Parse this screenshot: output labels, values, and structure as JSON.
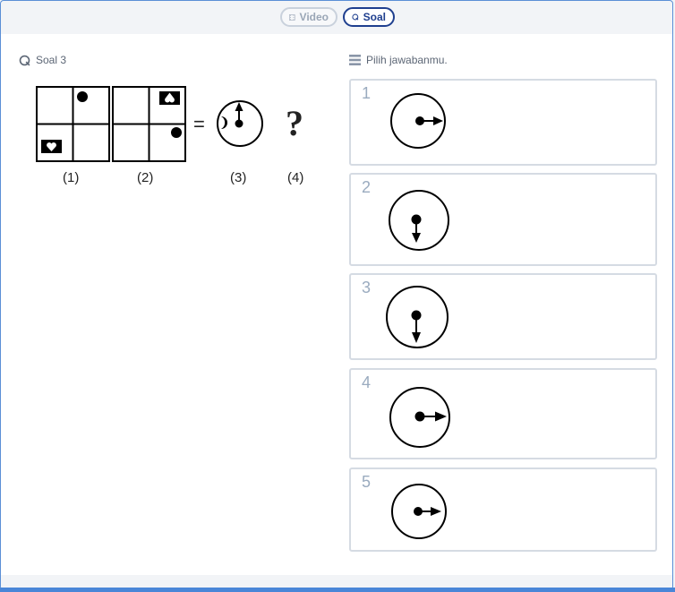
{
  "tabs": {
    "video_label": "Video",
    "soal_label": "Soal"
  },
  "question": {
    "title": "Soal 3",
    "figure_labels": [
      "(1)",
      "(2)",
      "(3)",
      "(4)"
    ],
    "equals": "=",
    "question_mark": "?"
  },
  "answers": {
    "header": "Pilih jawabanmu.",
    "options": [
      {
        "number": "1"
      },
      {
        "number": "2"
      },
      {
        "number": "3"
      },
      {
        "number": "4"
      },
      {
        "number": "5"
      }
    ]
  },
  "colors": {
    "accent": "#1f3f8f",
    "frame": "#4a86d8",
    "option_border": "#d5dbe3"
  }
}
